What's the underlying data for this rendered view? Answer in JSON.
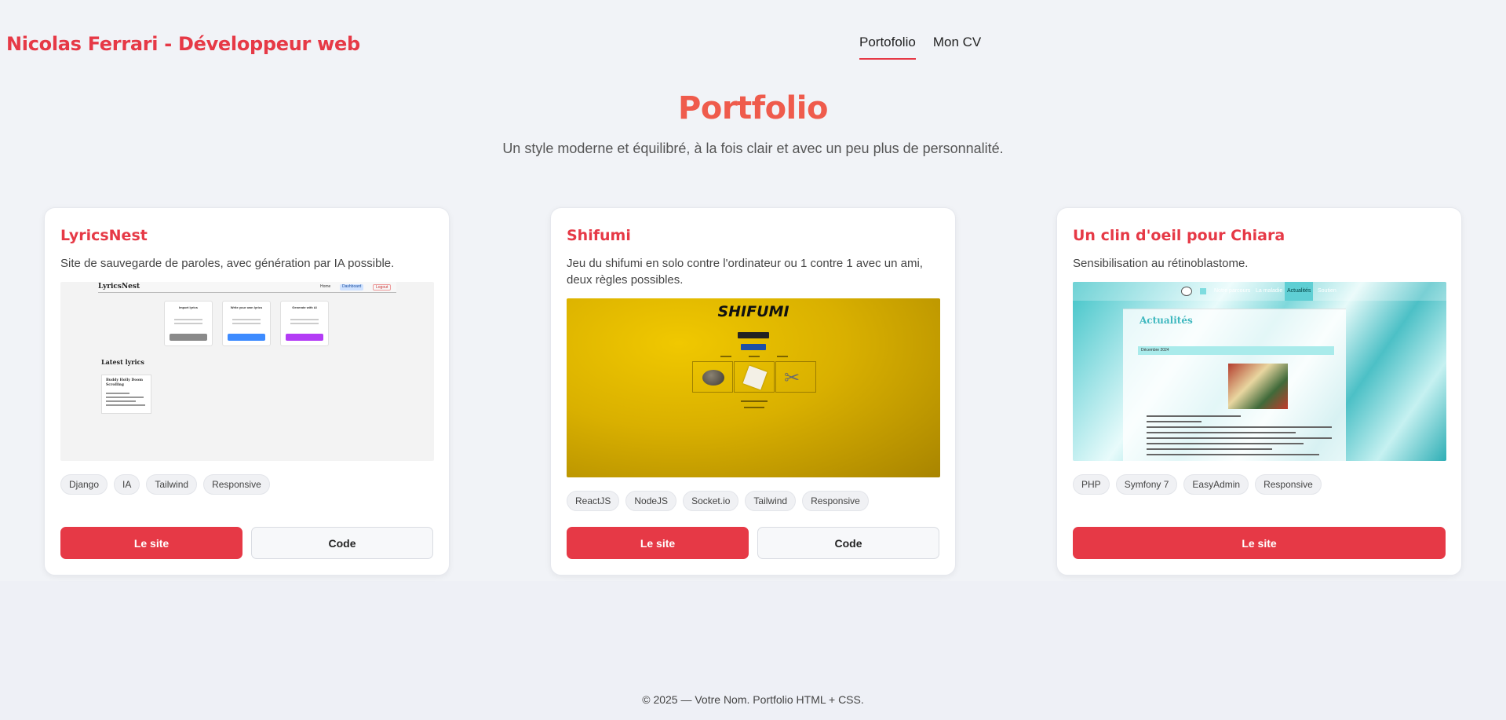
{
  "header": {
    "brand": "Nicolas Ferrari - Développeur web",
    "nav": [
      {
        "label": "Portofolio",
        "active": true
      },
      {
        "label": "Mon CV",
        "active": false
      }
    ]
  },
  "hero": {
    "title": "Portfolio",
    "subtitle": "Un style moderne et équilibré, à la fois clair et avec un peu plus de personnalité."
  },
  "projects": [
    {
      "title": "LyricsNest",
      "description": "Site de sauvegarde de paroles, avec génération par IA possible.",
      "tags": [
        "Django",
        "IA",
        "Tailwind",
        "Responsive"
      ],
      "buttons": {
        "site": "Le site",
        "code": "Code"
      },
      "thumb": {
        "logo": "LyricsNest",
        "nav": [
          "Home",
          "Dashboard",
          "Logout"
        ],
        "boxes": [
          {
            "title": "Import lyrics",
            "button": "Import file"
          },
          {
            "title": "Write your own lyrics",
            "button": "Write yourself"
          },
          {
            "title": "Generate with AI",
            "button": "Generate"
          }
        ],
        "section_title": "Latest lyrics",
        "note_title": "Buddy Holly Doom Scrolling"
      }
    },
    {
      "title": "Shifumi",
      "description": "Jeu du shifumi en solo contre l'ordinateur ou 1 contre 1 avec un ami, deux règles possibles.",
      "tags": [
        "ReactJS",
        "NodeJS",
        "Socket.io",
        "Tailwind",
        "Responsive"
      ],
      "buttons": {
        "site": "Le site",
        "code": "Code"
      },
      "thumb": {
        "logo": "SHIFUMI"
      }
    },
    {
      "title": "Un clin d'oeil pour Chiara",
      "description": "Sensibilisation au rétinoblastome.",
      "tags": [
        "PHP",
        "Symfony 7",
        "EasyAdmin",
        "Responsive"
      ],
      "buttons": {
        "site": "Le site"
      },
      "thumb": {
        "nav": [
          "Notre parcours",
          "La maladie",
          "Actualités",
          "Soutien"
        ],
        "panel_title": "Actualités",
        "date": "Décembre 2024"
      }
    }
  ],
  "footer": {
    "text": "© 2025 — Votre Nom. Portfolio HTML + CSS."
  },
  "colors": {
    "accent": "#e63946",
    "title": "#ef5b4c",
    "background": "#f1f3f7"
  }
}
